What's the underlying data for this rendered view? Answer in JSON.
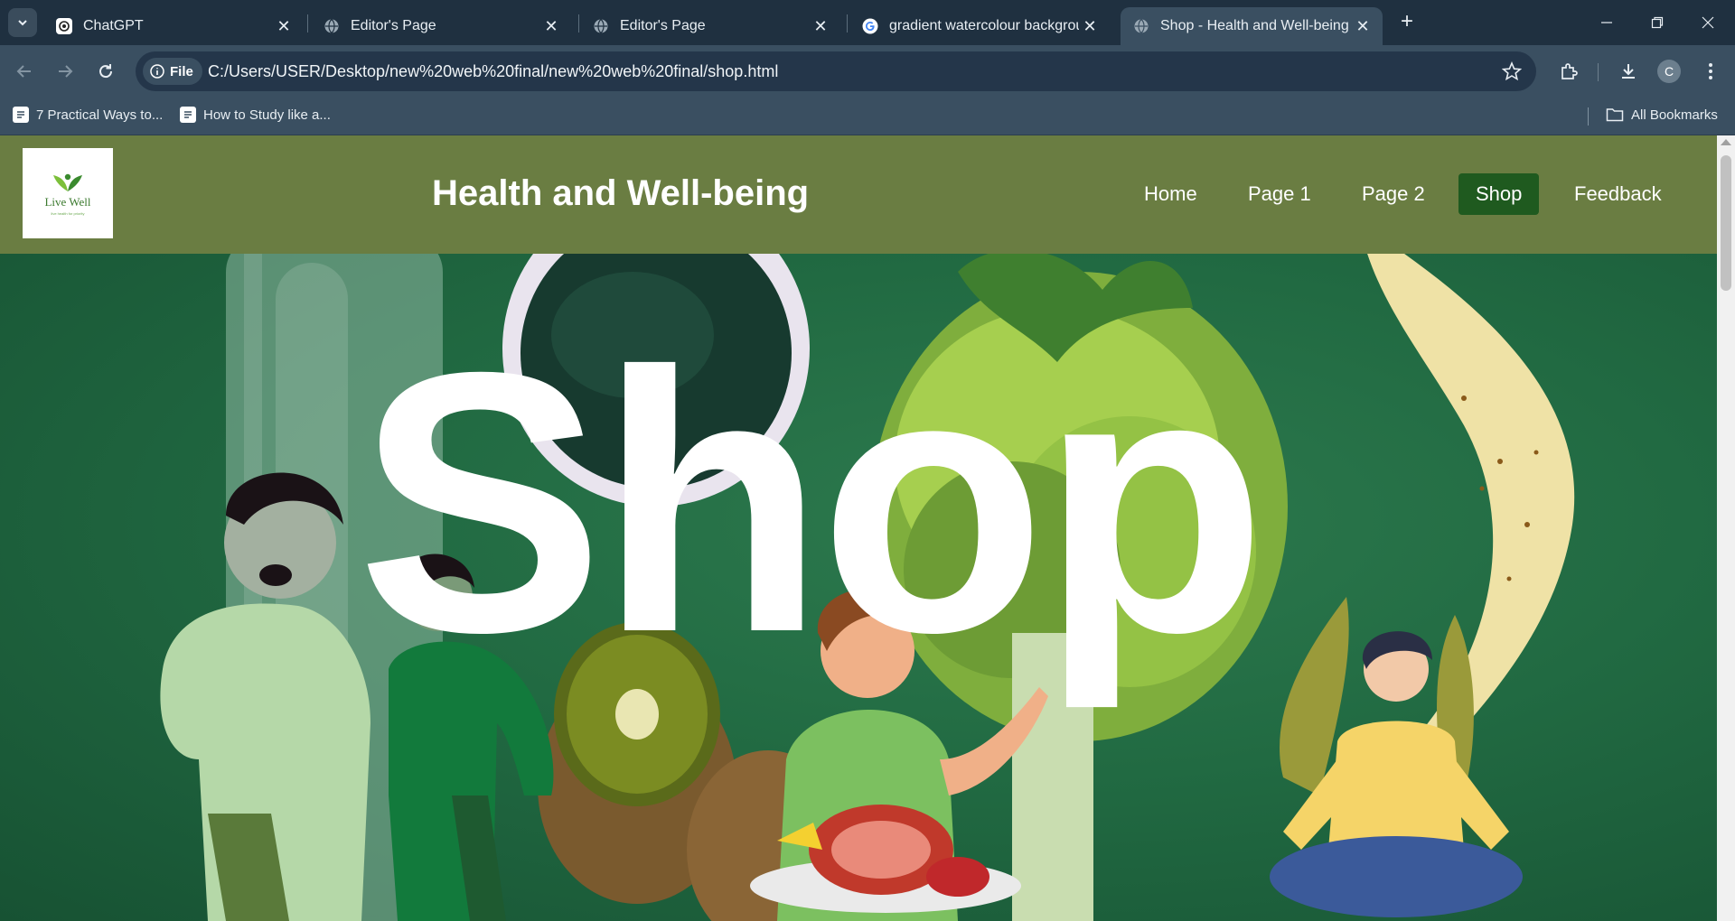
{
  "browser": {
    "tabs": [
      {
        "title": "ChatGPT",
        "favicon": "chatgpt-icon",
        "active": false
      },
      {
        "title": "Editor's Page",
        "favicon": "globe-icon",
        "active": false
      },
      {
        "title": "Editor's Page",
        "favicon": "globe-icon",
        "active": false
      },
      {
        "title": "gradient watercolour backgrour",
        "favicon": "google-icon",
        "active": false
      },
      {
        "title": "Shop - Health and Well-being",
        "favicon": "globe-icon",
        "active": true
      }
    ],
    "address_chip": "File",
    "url": "C:/Users/USER/Desktop/new%20web%20final/new%20web%20final/shop.html",
    "profile_initial": "C",
    "bookmarks": [
      {
        "label": "7 Practical Ways to...",
        "icon": "notes-icon"
      },
      {
        "label": "How to Study like a...",
        "icon": "notes-icon"
      }
    ],
    "all_bookmarks": "All Bookmarks"
  },
  "site": {
    "logo_text": "Live Well",
    "logo_tagline": "live health for priority",
    "title": "Health and Well-being",
    "nav": [
      {
        "label": "Home",
        "active": false
      },
      {
        "label": "Page 1",
        "active": false
      },
      {
        "label": "Page 2",
        "active": false
      },
      {
        "label": "Shop",
        "active": true
      },
      {
        "label": "Feedback",
        "active": false
      }
    ]
  },
  "hero": {
    "heading": "Shop"
  },
  "colors": {
    "chrome_dark": "#1f3040",
    "chrome": "#3a4f61",
    "header_green": "#6a7d42",
    "nav_active": "#1f5a1f",
    "hero_green": "#216a42"
  }
}
